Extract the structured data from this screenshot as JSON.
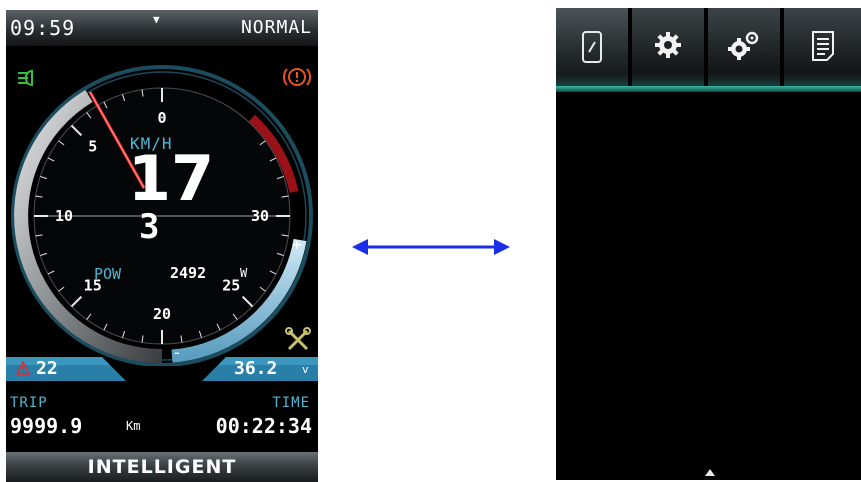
{
  "status_bar": {
    "time": "09:59",
    "mode": "NORMAL"
  },
  "gauge": {
    "unit": "KM/H",
    "speed": "17",
    "gear": "3",
    "tick_labels": [
      "0",
      "5",
      "10",
      "15",
      "20",
      "25",
      "30"
    ],
    "power_label": "POW",
    "power_value": "2492",
    "power_unit": "W",
    "battery_plus": "+",
    "battery_minus": "-"
  },
  "indicators": {
    "temperature": "22",
    "voltage": "36.2",
    "voltage_unit": "v"
  },
  "trip": {
    "label": "TRIP",
    "value": "9999.9",
    "unit": "Km"
  },
  "ride_time": {
    "label": "TIME",
    "value": "00:22:34"
  },
  "footer": {
    "label": "INTELLIGENT"
  },
  "colors": {
    "accent": "#4fb6d3",
    "redline": "#b5141b",
    "arrow": "#1a2ee8",
    "menu_teal": "#36b7a4"
  },
  "icons": {
    "left": [
      "headlight-icon",
      "warning-icon",
      "wrench-icon",
      "pulldown-icon",
      "alert-icon"
    ],
    "right_menu": [
      "device-icon",
      "gear-icon",
      "gears-icon",
      "document-icon"
    ],
    "right_bottom": "pull-up-icon"
  }
}
